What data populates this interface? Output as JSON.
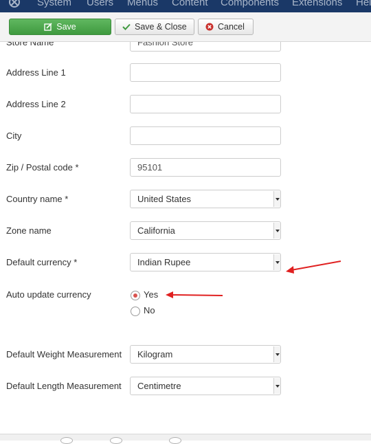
{
  "nav": {
    "items": [
      {
        "label": "System"
      },
      {
        "label": "Users"
      },
      {
        "label": "Menus"
      },
      {
        "label": "Content"
      },
      {
        "label": "Components"
      },
      {
        "label": "Extensions"
      },
      {
        "label": "Hel"
      }
    ]
  },
  "toolbar": {
    "save_label": "Save",
    "save_close_label": "Save & Close",
    "cancel_label": "Cancel"
  },
  "form": {
    "store_name": {
      "label": "Store Name",
      "value": "Fashion Store"
    },
    "address1": {
      "label": "Address Line 1",
      "value": ""
    },
    "address2": {
      "label": "Address Line 2",
      "value": ""
    },
    "city": {
      "label": "City",
      "value": ""
    },
    "zip": {
      "label": "Zip / Postal code *",
      "value": "95101"
    },
    "country": {
      "label": "Country name *",
      "value": "United States"
    },
    "zone": {
      "label": "Zone name",
      "value": "California"
    },
    "currency": {
      "label": "Default currency *",
      "value": "Indian Rupee"
    },
    "auto_update": {
      "label": "Auto update currency",
      "options": [
        "Yes",
        "No"
      ],
      "selected": "Yes"
    },
    "weight": {
      "label": "Default Weight Measurement",
      "value": "Kilogram"
    },
    "length": {
      "label": "Default Length Measurement",
      "value": "Centimetre"
    }
  },
  "colors": {
    "navbar": "#1a3867",
    "save_button": "#4aa84a",
    "radio_selected": "#d9534f",
    "annotation_arrow": "#e02020"
  }
}
